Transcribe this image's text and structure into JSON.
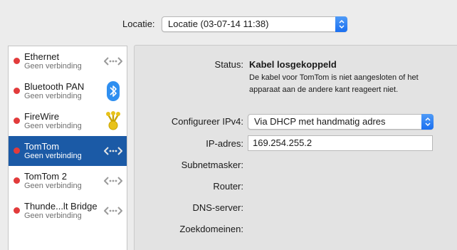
{
  "location": {
    "label": "Locatie:",
    "value": "Locatie (03-07-14 11:38)"
  },
  "services": [
    {
      "name": "Ethernet",
      "status": "Geen verbinding",
      "icon": "ethernet-arrows-icon",
      "selected": false
    },
    {
      "name": "Bluetooth PAN",
      "status": "Geen verbinding",
      "icon": "bluetooth-icon",
      "selected": false
    },
    {
      "name": "FireWire",
      "status": "Geen verbinding",
      "icon": "firewire-icon",
      "selected": false
    },
    {
      "name": "TomTom",
      "status": "Geen verbinding",
      "icon": "ethernet-arrows-icon",
      "selected": true
    },
    {
      "name": "TomTom 2",
      "status": "Geen verbinding",
      "icon": "ethernet-arrows-icon",
      "selected": false
    },
    {
      "name": "Thunde...lt Bridge",
      "status": "Geen verbinding",
      "icon": "ethernet-arrows-icon",
      "selected": false
    }
  ],
  "details": {
    "status_label": "Status:",
    "status_value": "Kabel losgekoppeld",
    "status_description": "De kabel voor TomTom is niet aangesloten of het apparaat aan de andere kant reageert niet.",
    "configure_label": "Configureer IPv4:",
    "configure_value": "Via DHCP met handmatig adres",
    "ip_label": "IP-adres:",
    "ip_value": "169.254.255.2",
    "subnet_label": "Subnetmasker:",
    "router_label": "Router:",
    "dns_label": "DNS-server:",
    "search_label": "Zoekdomeinen:"
  },
  "colors": {
    "selection": "#1b5aa6",
    "status_dot": "#e23b3b",
    "accent": "#1a6ff0"
  }
}
